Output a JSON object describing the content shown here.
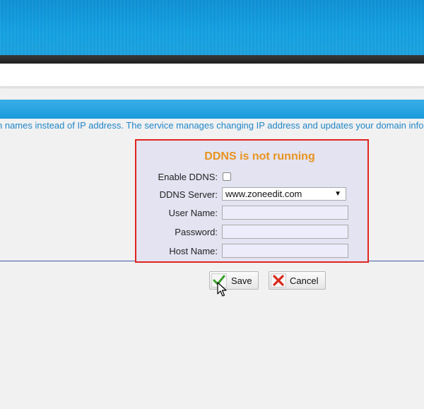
{
  "description": "n names instead of IP address. The service manages changing IP address and updates your domain info",
  "ddns": {
    "status": "DDNS is not running",
    "enable_label": "Enable DDNS:",
    "enable_checked": false,
    "server_label": "DDNS Server:",
    "server_value": "www.zoneedit.com",
    "username_label": "User Name:",
    "username_value": "",
    "password_label": "Password:",
    "password_value": "",
    "hostname_label": "Host Name:",
    "hostname_value": ""
  },
  "buttons": {
    "save_label": "Save",
    "cancel_label": "Cancel"
  },
  "icons": {
    "save": "checkmark-icon",
    "cancel": "red-x-icon",
    "dropdown": "triangle-down-icon"
  },
  "colors": {
    "accent_blue": "#1a9bdc",
    "status_orange": "#e8931e",
    "panel_border": "#e0241c",
    "panel_bg": "#e3e3f2",
    "description_text": "#1f86c8"
  }
}
